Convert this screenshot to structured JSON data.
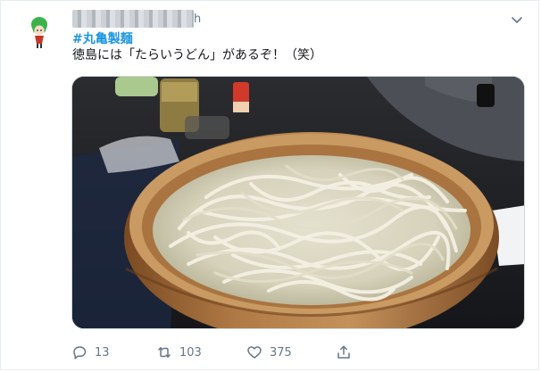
{
  "tweet": {
    "username_tail": "h",
    "hashtag": "#丸亀製麺",
    "text": "徳島には「たらいうどん」があるぞ！（笑）",
    "actions": {
      "reply_count": "13",
      "retweet_count": "103",
      "like_count": "375"
    }
  },
  "colors": {
    "link": "#1b95e0",
    "secondary_text": "#657786",
    "border": "#e6ecf0"
  },
  "icons": {
    "more": "chevron-down-icon",
    "reply": "reply-icon",
    "retweet": "retweet-icon",
    "like": "heart-icon",
    "share": "share-icon"
  }
}
